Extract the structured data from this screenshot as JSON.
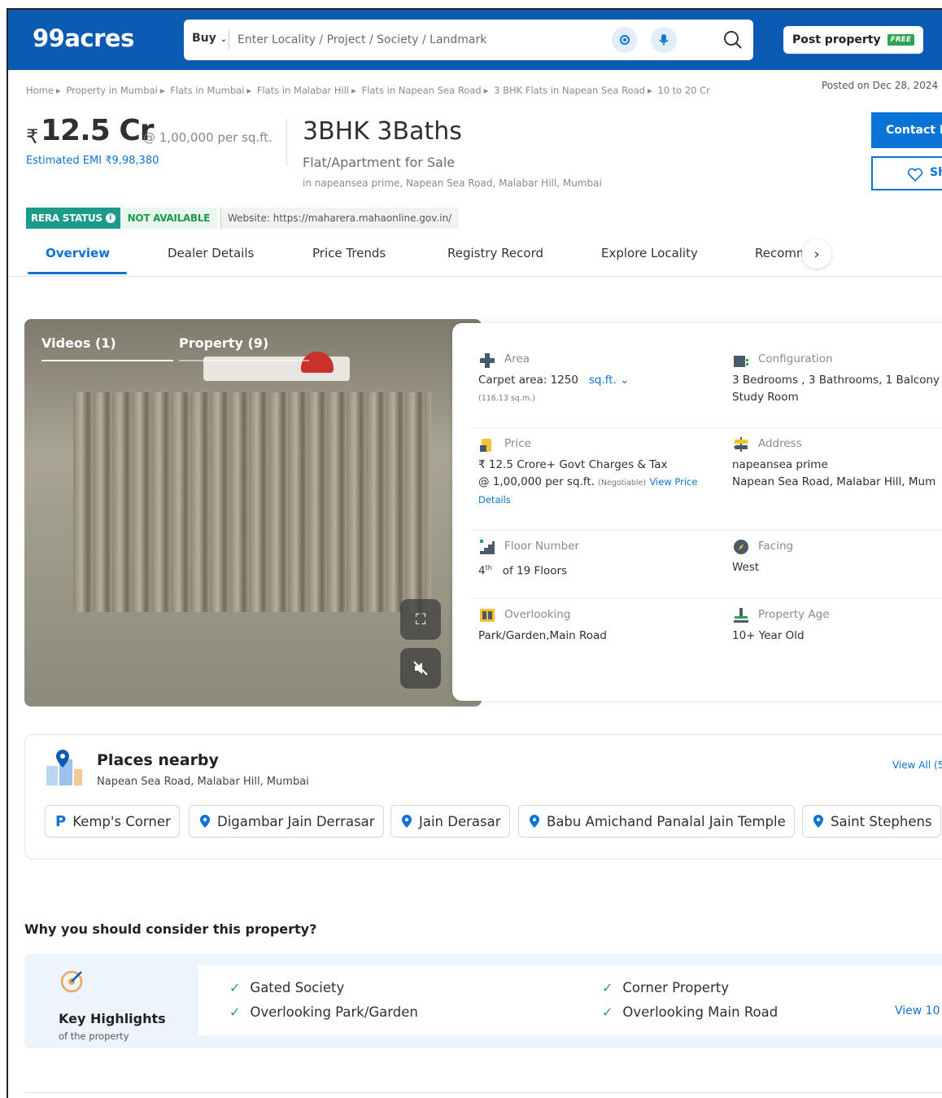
{
  "header": {
    "logo": "99acres",
    "buy_label": "Buy",
    "search_placeholder": "Enter Locality / Project / Society / Landmark",
    "post_property_label": "Post property",
    "free_badge": "FREE"
  },
  "breadcrumb": [
    "Home",
    "Property in Mumbai",
    "Flats in Mumbai",
    "Flats in Malabar Hill",
    "Flats in Napean Sea Road",
    "3 BHK Flats in Napean Sea Road",
    "10 to 20 Cr"
  ],
  "posted_on": "Posted on Dec 28, 2024",
  "listing": {
    "currency_symbol": "₹",
    "price": "12.5 Cr",
    "rate": "@ 1,00,000 per sq.ft.",
    "emi": "Estimated EMI ₹9,98,380",
    "title": "3BHK 3Baths",
    "subtitle": "Flat/Apartment for Sale",
    "location": "in napeansea prime, Napean Sea Road, Malabar Hill, Mumbai",
    "contact_label": "Contact D",
    "shortlist_label": "Sh"
  },
  "rera": {
    "status_label": "RERA STATUS",
    "status_value": "NOT AVAILABLE",
    "website": "Website: https://maharera.mahaonline.gov.in/"
  },
  "tabs": [
    "Overview",
    "Dealer Details",
    "Price Trends",
    "Registry Record",
    "Explore Locality",
    "Recomm"
  ],
  "media": {
    "tab_videos": "Videos (1)",
    "tab_property": "Property (9)"
  },
  "details": {
    "area_label": "Area",
    "area_value": "Carpet area: 1250",
    "area_unit": "sq.ft.",
    "area_sqm": "(116.13 sq.m.)",
    "config_label": "Configuration",
    "config_line1": "3 Bedrooms , 3 Bathrooms, 1 Balcony",
    "config_line2": "Study Room",
    "price_label": "Price",
    "price_line1": "₹ 12.5 Crore+ Govt Charges & Tax",
    "price_line2": "@ 1,00,000 per sq.ft.",
    "price_negotiable": "(Negotiable)",
    "price_link1": "View Price",
    "price_link2": "Details",
    "address_label": "Address",
    "address_line1": "napeansea prime",
    "address_line2": "Napean Sea Road, Malabar Hill, Mum",
    "floor_label": "Floor Number",
    "floor_num": "4",
    "floor_sup": "th",
    "floor_total": "of 19 Floors",
    "facing_label": "Facing",
    "facing_value": "West",
    "overlooking_label": "Overlooking",
    "overlooking_value": "Park/Garden,Main Road",
    "age_label": "Property Age",
    "age_value": "10+ Year Old"
  },
  "places": {
    "title": "Places nearby",
    "subtitle": "Napean Sea Road, Malabar Hill, Mumbai",
    "view_all": "View All (5",
    "chips": [
      "Kemp's Corner",
      "Digambar Jain Derrasar",
      "Jain Derasar",
      "Babu Amichand Panalal Jain Temple",
      "Saint Stephens"
    ]
  },
  "why": {
    "title": "Why you should consider this property?",
    "kh_title": "Key Highlights",
    "kh_sub": "of the property",
    "items": [
      "Gated Society",
      "Corner Property",
      "Overlooking Park/Garden",
      "Overlooking Main Road"
    ],
    "view_more": "View 10"
  },
  "colors": {
    "brand_blue": "#0a5bb1",
    "link_blue": "#0a73d6",
    "rera_teal": "#1c9a8a",
    "green": "#2aa44f"
  }
}
